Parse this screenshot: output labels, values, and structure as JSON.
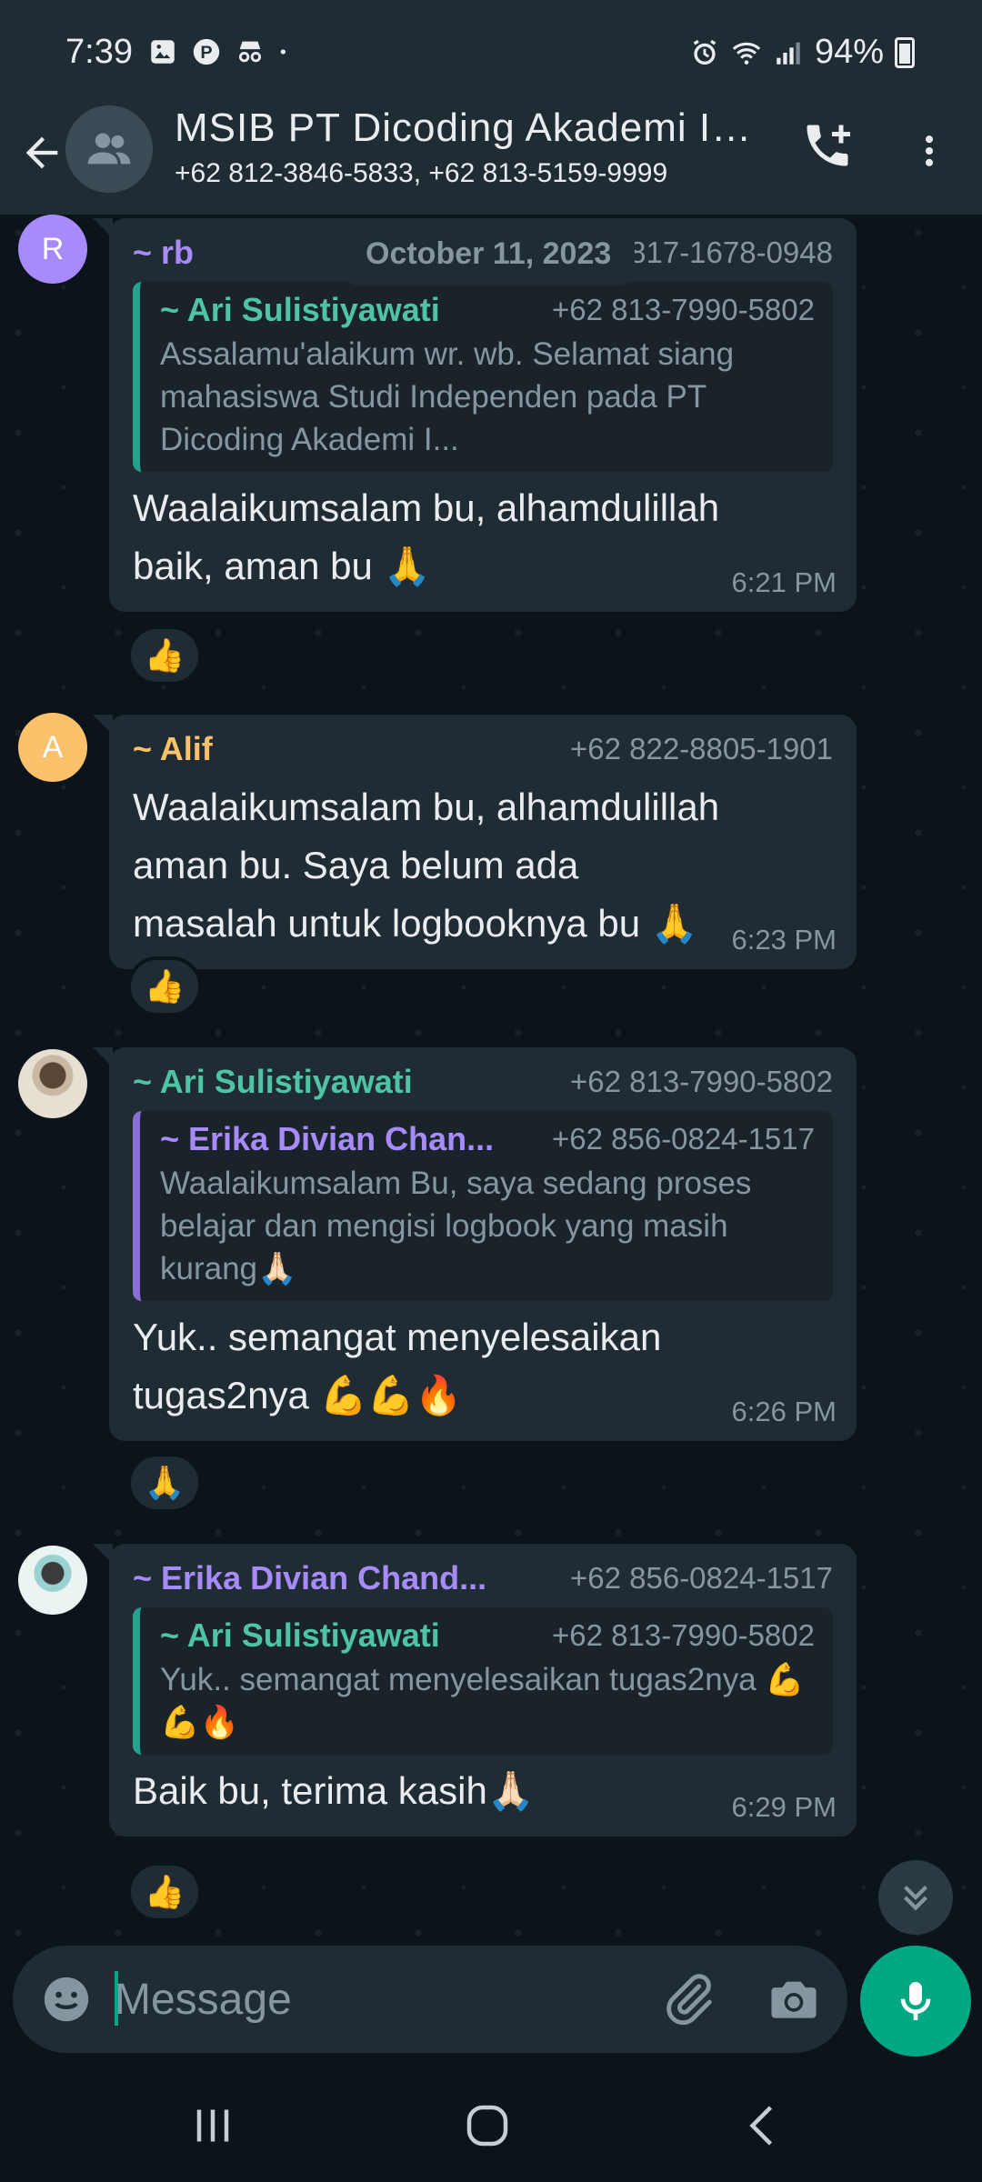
{
  "status_bar": {
    "time": "7:39",
    "battery": "94%"
  },
  "header": {
    "title": "MSIB PT Dicoding Akademi Indonesia",
    "subtitle": "+62 812-3846-5833, +62 813-5159-9999"
  },
  "date_pill": "October 11, 2023",
  "colors": {
    "accent": "#00a884",
    "bubble": "#202c33",
    "background": "#0b141a",
    "header": "#1f2c34"
  },
  "messages": [
    {
      "avatar_letter": "R",
      "sender": "~ rb",
      "sender_color": "#a78bfa",
      "phone": "+62 817-1678-0948",
      "quote": {
        "name": "~ Ari Sulistiyawati",
        "name_color": "#53bdeb",
        "bar_color": "#25a18e",
        "phone": "+62 813-7990-5802",
        "text": "Assalamu'alaikum wr. wb. Selamat siang mahasiswa Studi Independen pada PT Dicoding Akademi I..."
      },
      "text": "Waalaikumsalam bu, alhamdulillah baik, aman bu 🙏",
      "time": "6:21 PM",
      "reaction": "👍"
    },
    {
      "avatar_letter": "A",
      "sender": "~ Alif",
      "sender_color": "#fcc16b",
      "phone": "+62 822-8805-1901",
      "text": "Waalaikumsalam bu, alhamdulillah aman bu. Saya belum ada masalah untuk logbooknya bu 🙏",
      "time": "6:23 PM",
      "reaction": "👍"
    },
    {
      "sender": "~ Ari Sulistiyawati",
      "sender_color": "#4fc3a6",
      "phone": "+62 813-7990-5802",
      "quote": {
        "name": "~ Erika Divian Chan...",
        "name_color": "#a78bfa",
        "bar_color": "#8b6fd6",
        "phone": "+62 856-0824-1517",
        "text": "Waalaikumsalam Bu, saya sedang proses belajar dan mengisi logbook yang masih kurang🙏🏻"
      },
      "text": "Yuk.. semangat menyelesaikan tugas2nya 💪💪🔥",
      "time": "6:26 PM",
      "reaction": "🙏"
    },
    {
      "sender": "~ Erika Divian Chand...",
      "sender_color": "#a78bfa",
      "phone": "+62 856-0824-1517",
      "quote": {
        "name": "~ Ari Sulistiyawati",
        "name_color": "#4fc3a6",
        "bar_color": "#25a18e",
        "phone": "+62 813-7990-5802",
        "text": "Yuk.. semangat menyelesaikan tugas2nya 💪💪🔥"
      },
      "text": "Baik bu, terima kasih🙏🏻",
      "time": "6:29 PM",
      "reaction": "👍"
    }
  ],
  "input": {
    "placeholder": "Message"
  },
  "icons": {
    "back": "arrow-left-icon",
    "group": "group-icon",
    "add_call": "add-call-icon",
    "menu": "more-vert-icon",
    "emoji": "emoji-icon",
    "attach": "paperclip-icon",
    "camera": "camera-icon",
    "mic": "microphone-icon",
    "scroll": "double-chevron-down-icon"
  }
}
